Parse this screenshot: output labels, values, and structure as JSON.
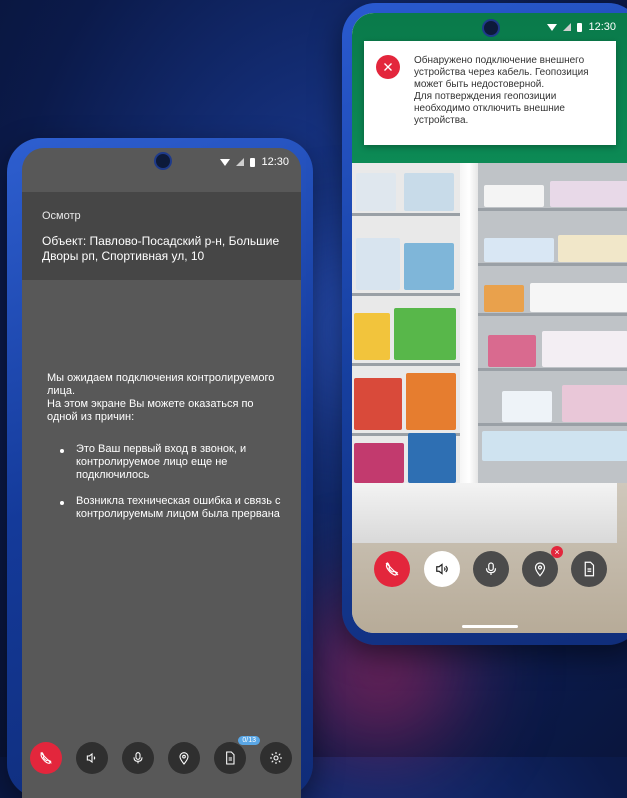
{
  "status_bar": {
    "time": "12:30"
  },
  "left_phone": {
    "header_label": "Осмотр",
    "address": "Объект: Павлово-Посадский р-н, Большие Дворы рп, Спортивная ул, 10",
    "waiting_line1": "Мы ожидаем подключения контролируемого лица.",
    "waiting_line2": "На этом экране Вы можете оказаться по одной из причин:",
    "reasons": [
      "Это Ваш первый вход в звонок, и контролируемое лицо еще не подключилось",
      "Возникла техническая ошибка и связь с контролируемым лицом была прервана"
    ],
    "docs_badge": "0/13",
    "icons": [
      "end-call-icon",
      "speaker-icon",
      "microphone-icon",
      "location-icon",
      "document-icon",
      "settings-icon"
    ]
  },
  "right_phone": {
    "toast": {
      "line1": "Обнаружено подключение внешнего устройства через кабель. Геопозиция может быть недостоверной.",
      "line2": "Для потверждения геопозиции необходимо отключить внешние устройства."
    },
    "location_warning": "×",
    "icons": [
      "end-call-icon",
      "speaker-icon",
      "microphone-icon",
      "location-icon",
      "document-icon"
    ]
  },
  "colors": {
    "accent_red": "#e3263c",
    "badge_blue": "#5aa7e6",
    "screen_gray": "#585858"
  }
}
